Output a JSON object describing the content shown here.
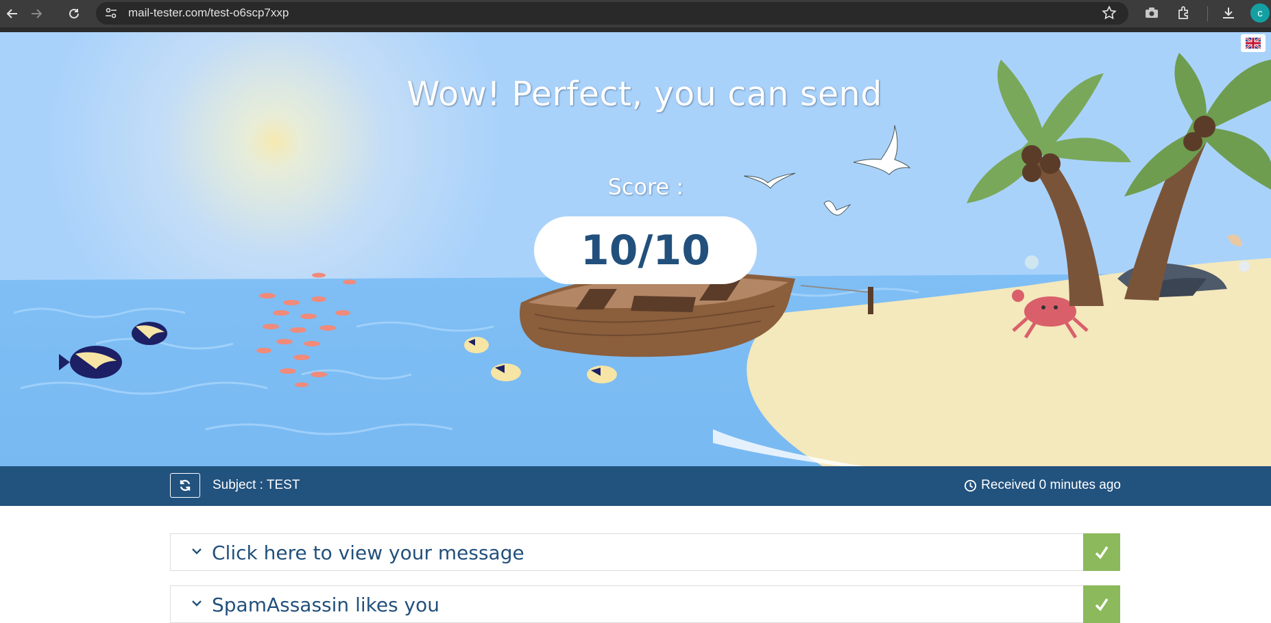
{
  "browser": {
    "url": "mail-tester.com/test-o6scp7xxp",
    "profile_initial": "c"
  },
  "hero": {
    "title": "Wow! Perfect, you can send",
    "score_label": "Score :",
    "score_value": "10/10"
  },
  "subject_bar": {
    "subject": "Subject : TEST",
    "received": "Received 0 minutes ago"
  },
  "accordion": [
    {
      "label": "Click here to view your message",
      "status": "pass"
    },
    {
      "label": "SpamAssassin likes you",
      "status": "pass"
    }
  ],
  "colors": {
    "bar": "#22527e",
    "score_text": "#22507c",
    "pass": "#8cb95c",
    "sky": "#a9d2fb",
    "sea": "#7fbff5",
    "sand": "#f4e8bd"
  }
}
